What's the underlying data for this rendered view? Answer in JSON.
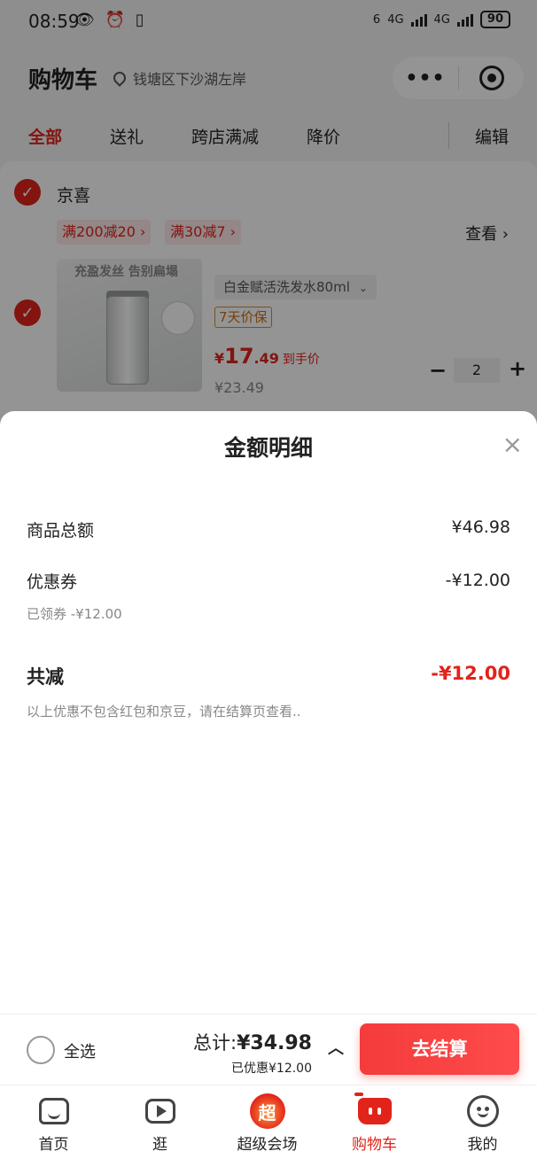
{
  "status_bar": {
    "time": "08:59",
    "left_icons": "👁 ⏰ ▯",
    "network_1": "4G",
    "network_2": "4G",
    "wifi_label": "6",
    "battery": "90"
  },
  "header": {
    "title": "购物车",
    "location": "钱塘区下沙湖左岸",
    "capsule_more": "•••"
  },
  "tabs": [
    "全部",
    "送礼",
    "跨店满减",
    "降价"
  ],
  "tab_edit": "编辑",
  "shop": {
    "name": "京喜",
    "promos": [
      "满200减20 ›",
      "满30减7 ›"
    ],
    "view": "查看 ›",
    "product": {
      "image_slogan": "充盈发丝 告别扁塌",
      "variant": "白金赋活洗发水80ml",
      "price_protect": "7天价保",
      "price_symbol": "¥",
      "price_int": "17",
      "price_dec": ".49",
      "price_note": "到手价",
      "original_price": "¥23.49",
      "quantity": "2"
    }
  },
  "sheet": {
    "title": "金额明细",
    "goods_total_label": "商品总额",
    "goods_total_value": "¥46.98",
    "coupon_label": "优惠券",
    "coupon_value": "-¥12.00",
    "coupon_sub": "已领券 -¥12.00",
    "total_off_label": "共减",
    "total_off_value": "-¥12.00",
    "note": "以上优惠不包含红包和京豆，请在结算页查看.."
  },
  "checkout": {
    "select_all": "全选",
    "total_prefix": "总计:",
    "total_amount": "¥34.98",
    "saved": "已优惠¥12.00",
    "button": "去结算"
  },
  "tabbar": [
    {
      "label": "首页",
      "icon": "home-icon"
    },
    {
      "label": "逛",
      "icon": "video-icon"
    },
    {
      "label": "超级会场",
      "icon": "super-venue-icon"
    },
    {
      "label": "购物车",
      "icon": "cart-icon",
      "active": true
    },
    {
      "label": "我的",
      "icon": "profile-icon"
    }
  ],
  "colors": {
    "accent": "#e2231a",
    "checkout_button": "#f53b3b",
    "price_protect": "#d06c10"
  }
}
